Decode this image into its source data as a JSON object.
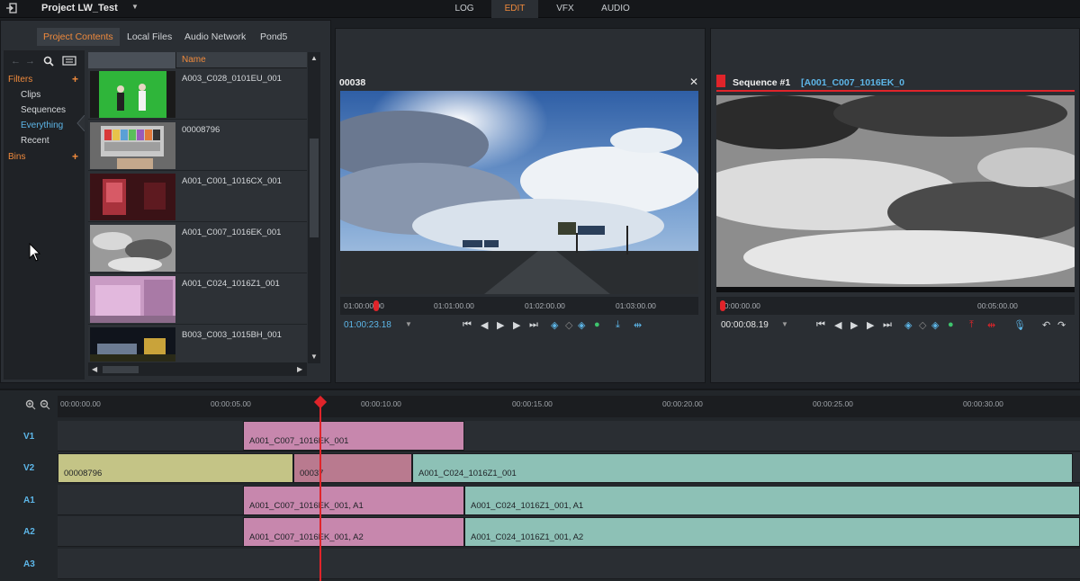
{
  "app": {
    "project_title": "Project LW_Test",
    "modes": [
      "LOG",
      "EDIT",
      "VFX",
      "AUDIO"
    ],
    "active_mode": "EDIT"
  },
  "browser": {
    "tabs": [
      "Project Contents",
      "Local Files",
      "Audio Network",
      "Pond5"
    ],
    "active_tab": "Project Contents",
    "filters_label": "Filters",
    "bins_label": "Bins",
    "filter_items": [
      "Clips",
      "Sequences",
      "Everything",
      "Recent"
    ],
    "selected_filter": "Everything",
    "name_header": "Name",
    "clips": [
      {
        "name": "A003_C028_0101EU_001",
        "thumb": "greenscreen"
      },
      {
        "name": "00008796",
        "thumb": "testchart"
      },
      {
        "name": "A001_C001_1016CX_001",
        "thumb": "redroom"
      },
      {
        "name": "A001_C007_1016EK_001",
        "thumb": "clouds-bw"
      },
      {
        "name": "A001_C024_1016Z1_001",
        "thumb": "pink-building"
      },
      {
        "name": "B003_C003_1015BH_001",
        "thumb": "night"
      }
    ]
  },
  "source_viewer": {
    "title": "00038",
    "ruler_ticks": [
      "01:00:00.00",
      "01:01:00.00",
      "01:02:00.00",
      "01:03:00.00"
    ],
    "timecode": "01:00:23.18",
    "playhead_fraction": 0.12
  },
  "record_viewer": {
    "title": "Sequence #1",
    "clip_name": "[A001_C007_1016EK_0",
    "ruler_ticks": [
      "00:00:00.00",
      "00:05:00.00"
    ],
    "timecode": "00:00:08.19",
    "playhead_fraction": 0.01
  },
  "timeline": {
    "ruler_ticks": [
      "00:00:00.00",
      "00:00:05.00",
      "00:00:10.00",
      "00:00:15.00",
      "00:00:20.00",
      "00:00:25.00",
      "00:00:30.00"
    ],
    "playhead_time": "00:00:08.70",
    "tracks": [
      {
        "label": "V1",
        "clips": [
          {
            "name": "A001_C007_1016EK_001"
          }
        ]
      },
      {
        "label": "V2",
        "clips": [
          {
            "name": "00008796"
          },
          {
            "name": "00037"
          },
          {
            "name": "A001_C024_1016Z1_001"
          }
        ]
      },
      {
        "label": "A1",
        "clips": [
          {
            "name": "A001_C007_1016EK_001, A1"
          },
          {
            "name": "A001_C024_1016Z1_001, A1"
          }
        ]
      },
      {
        "label": "A2",
        "clips": [
          {
            "name": "A001_C007_1016EK_001, A2"
          },
          {
            "name": "A001_C024_1016Z1_001, A2"
          }
        ]
      },
      {
        "label": "A3",
        "clips": []
      }
    ]
  },
  "colors": {
    "accent": "#f08a3c",
    "highlight": "#5db6e8",
    "playhead": "#e0242a"
  }
}
